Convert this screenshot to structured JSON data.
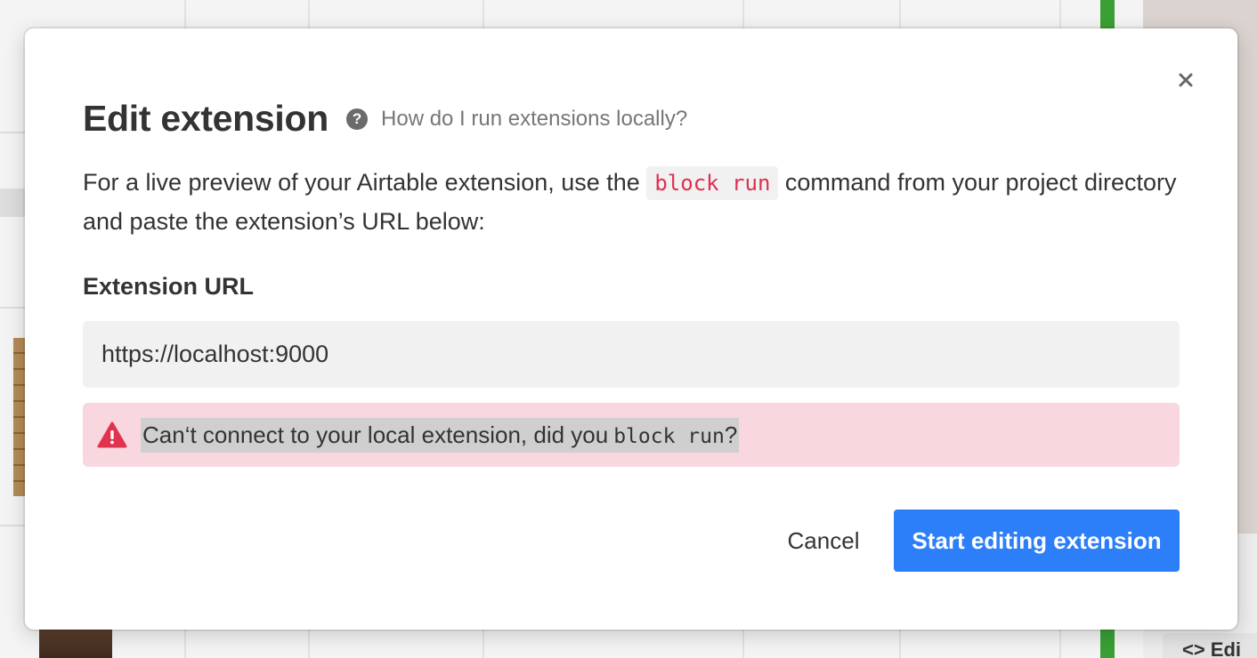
{
  "modal": {
    "title": "Edit extension",
    "help_link": "How do I run extensions locally?",
    "description_before": "For a live preview of your Airtable extension, use the",
    "description_code": "block run",
    "description_after": "command from your project directory and paste the extension’s URL below:",
    "field_label": "Extension URL",
    "url_value": "https://localhost:9000",
    "error_text": "Can‘t connect to your local extension, did you",
    "error_code": "block run",
    "error_suffix": "?",
    "cancel_label": "Cancel",
    "submit_label": "Start editing extension"
  },
  "background": {
    "edit_tab_label": "<> Edi"
  },
  "colors": {
    "primary": "#2d7ff9",
    "error_bg": "#f8d7df",
    "error_icon": "#e0334f",
    "code_text": "#e02e4f",
    "accent_green": "#3aa035"
  },
  "icons": {
    "close": "close-icon",
    "help": "question-circle-icon",
    "warning": "warning-triangle-icon"
  }
}
